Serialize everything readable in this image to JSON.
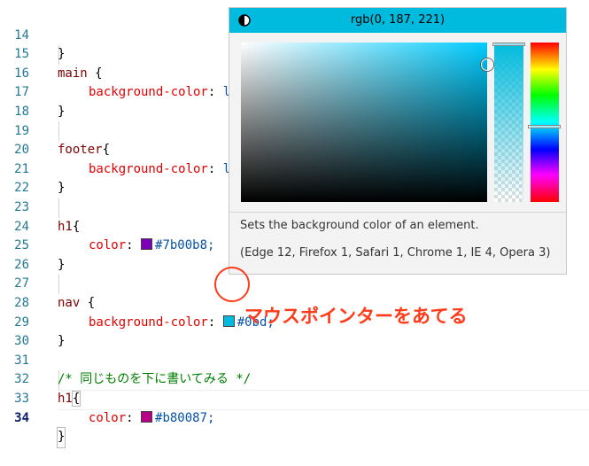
{
  "editor": {
    "lines": [
      {
        "num": "14",
        "text": "}"
      },
      {
        "num": "15",
        "selector": "main",
        "open": " {"
      },
      {
        "num": "16",
        "prop": "background-color",
        "colon": ": ",
        "value": "l"
      },
      {
        "num": "17",
        "text": "}"
      },
      {
        "num": "18"
      },
      {
        "num": "19",
        "selector": "footer",
        "open": "{"
      },
      {
        "num": "20",
        "prop": "background-color",
        "colon": ": ",
        "value": "l"
      },
      {
        "num": "21",
        "text": "}"
      },
      {
        "num": "22"
      },
      {
        "num": "23",
        "selector": "h1",
        "open": "{"
      },
      {
        "num": "24",
        "prop": "color",
        "colon": ": ",
        "value": "#7b00b8;",
        "swatch": "#7b00b8"
      },
      {
        "num": "25",
        "text": "}"
      },
      {
        "num": "26"
      },
      {
        "num": "27",
        "selector": "nav",
        "open": " {"
      },
      {
        "num": "28",
        "prop": "background-color",
        "colon": ": ",
        "value": "#0bd;",
        "swatch": "#00bbdd"
      },
      {
        "num": "29",
        "text": "}"
      },
      {
        "num": "30"
      },
      {
        "num": "31",
        "comment": "/* 同じものを下に書いてみる */"
      },
      {
        "num": "32",
        "selector": "h1",
        "open": "{"
      },
      {
        "num": "33",
        "prop": "color",
        "colon": ": ",
        "value": "#b80087;",
        "swatch": "#b80087"
      },
      {
        "num": "34",
        "text": "}"
      }
    ]
  },
  "color_hover": {
    "rgb_label": "rgb(0, 187, 221)",
    "current_color": "#00bbdd",
    "hue_level": 0.53,
    "opacity_level": 1.0,
    "description": "Sets the background color of an element.",
    "compatibility": "(Edge 12, Firefox 1, Safari 1, Chrome 1, IE 4, Opera 3)"
  },
  "annotation": {
    "text": "マウスポインターをあてる",
    "color": "#ff3b1a"
  },
  "colors": {
    "line_number": "#237893",
    "selector": "#800000",
    "property": "#e50000",
    "value": "#0451a5",
    "comment": "#008000"
  }
}
